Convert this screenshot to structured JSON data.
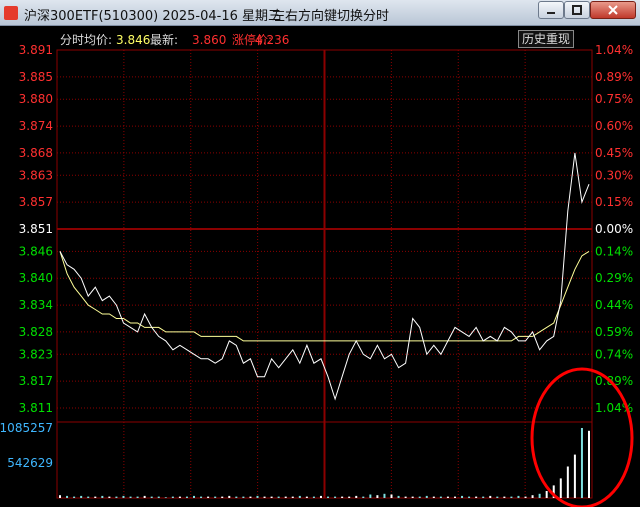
{
  "window": {
    "title": "沪深300ETF(510300) 2025-04-16 星期三",
    "hint": "左右方向键切换分时",
    "buttons": {
      "minimize": "minimize-icon",
      "maximize": "maximize-icon",
      "close": "close-icon"
    }
  },
  "header": {
    "label": "分时",
    "avg_label": "均价:",
    "avg_value": "3.846",
    "last_label": "最新:",
    "last_value": "3.860",
    "limit_label": "涨停价:",
    "limit_value": "4.236",
    "history_button": "历史重现"
  },
  "colors": {
    "background": "#000000",
    "grid": "#8b0000",
    "up": "#ff3030",
    "down": "#00e000",
    "price_line": "#ffffff",
    "avg_line": "#ffff99",
    "volume_label": "#3fb7ff",
    "annotation": "#ff0000"
  },
  "chart_data": {
    "type": "line",
    "prev_close": 3.851,
    "y_ticks_left": [
      "3.891",
      "3.885",
      "3.880",
      "3.874",
      "3.868",
      "3.863",
      "3.857",
      "3.851",
      "3.846",
      "3.840",
      "3.834",
      "3.828",
      "3.823",
      "3.817",
      "3.811"
    ],
    "y_ticks_right": [
      "1.04%",
      "0.89%",
      "0.75%",
      "0.60%",
      "0.45%",
      "0.30%",
      "0.15%",
      "0.00%",
      "0.14%",
      "0.29%",
      "0.44%",
      "0.59%",
      "0.74%",
      "0.89%",
      "1.04%"
    ],
    "ylim": [
      3.811,
      3.891
    ],
    "volume_ticks": [
      "1085257",
      "542629"
    ],
    "volume_max": 1085257,
    "price": [
      3.846,
      3.843,
      3.842,
      3.84,
      3.836,
      3.838,
      3.835,
      3.836,
      3.834,
      3.83,
      3.829,
      3.828,
      3.832,
      3.829,
      3.827,
      3.826,
      3.824,
      3.825,
      3.824,
      3.823,
      3.822,
      3.822,
      3.821,
      3.822,
      3.826,
      3.825,
      3.821,
      3.822,
      3.818,
      3.818,
      3.822,
      3.82,
      3.822,
      3.824,
      3.821,
      3.825,
      3.821,
      3.822,
      3.818,
      3.813,
      3.818,
      3.823,
      3.826,
      3.823,
      3.822,
      3.825,
      3.822,
      3.823,
      3.82,
      3.821,
      3.831,
      3.829,
      3.823,
      3.825,
      3.823,
      3.826,
      3.829,
      3.828,
      3.827,
      3.829,
      3.826,
      3.827,
      3.826,
      3.829,
      3.828,
      3.826,
      3.826,
      3.828,
      3.824,
      3.826,
      3.827,
      3.835,
      3.855,
      3.868,
      3.857,
      3.861
    ],
    "avg": [
      3.846,
      3.841,
      3.838,
      3.836,
      3.834,
      3.833,
      3.832,
      3.832,
      3.831,
      3.831,
      3.83,
      3.83,
      3.829,
      3.829,
      3.829,
      3.828,
      3.828,
      3.828,
      3.828,
      3.828,
      3.827,
      3.827,
      3.827,
      3.827,
      3.827,
      3.827,
      3.826,
      3.826,
      3.826,
      3.826,
      3.826,
      3.826,
      3.826,
      3.826,
      3.826,
      3.826,
      3.826,
      3.826,
      3.826,
      3.826,
      3.826,
      3.826,
      3.826,
      3.826,
      3.826,
      3.826,
      3.826,
      3.826,
      3.826,
      3.826,
      3.826,
      3.826,
      3.826,
      3.826,
      3.826,
      3.826,
      3.826,
      3.826,
      3.826,
      3.826,
      3.826,
      3.826,
      3.826,
      3.826,
      3.826,
      3.827,
      3.827,
      3.827,
      3.828,
      3.829,
      3.83,
      3.834,
      3.838,
      3.842,
      3.845,
      3.846
    ],
    "volume": [
      0.04,
      0.03,
      0.02,
      0.03,
      0.02,
      0.02,
      0.03,
      0.02,
      0.02,
      0.03,
      0.02,
      0.02,
      0.03,
      0.02,
      0.02,
      0.01,
      0.02,
      0.02,
      0.02,
      0.03,
      0.02,
      0.02,
      0.02,
      0.02,
      0.03,
      0.02,
      0.02,
      0.02,
      0.03,
      0.02,
      0.02,
      0.02,
      0.02,
      0.02,
      0.03,
      0.02,
      0.02,
      0.03,
      0.02,
      0.02,
      0.02,
      0.02,
      0.03,
      0.02,
      0.05,
      0.04,
      0.06,
      0.05,
      0.03,
      0.02,
      0.02,
      0.02,
      0.03,
      0.02,
      0.02,
      0.02,
      0.02,
      0.03,
      0.02,
      0.02,
      0.02,
      0.03,
      0.02,
      0.02,
      0.02,
      0.03,
      0.02,
      0.04,
      0.06,
      0.1,
      0.18,
      0.28,
      0.45,
      0.62,
      1.0,
      0.96
    ]
  }
}
